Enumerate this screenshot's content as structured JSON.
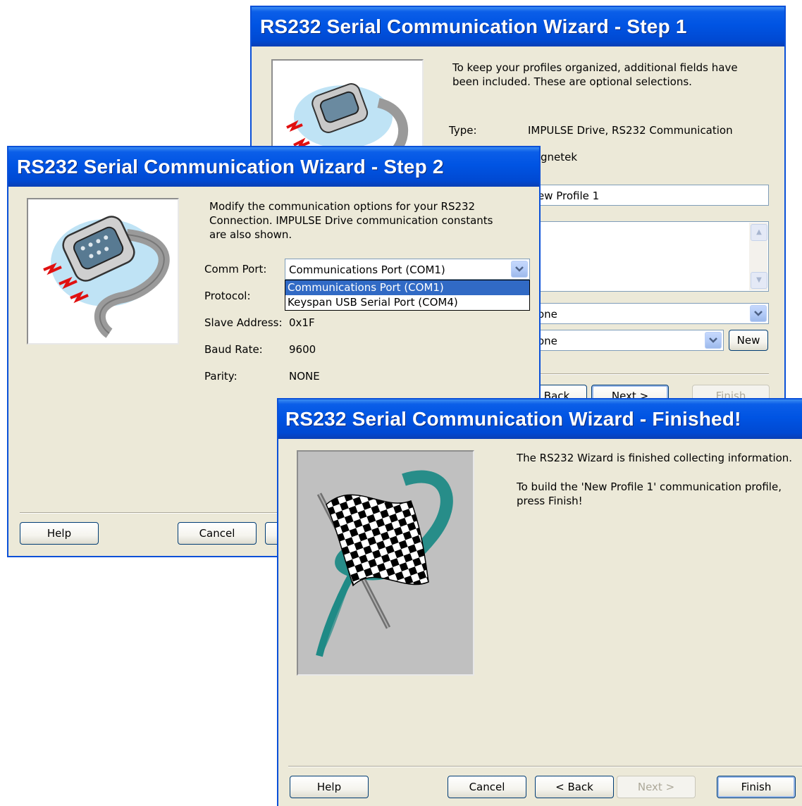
{
  "step1": {
    "title": "RS232 Serial Communication Wizard - Step 1",
    "intro": "To keep your profiles organized, additional fields have been included. These are optional selections.",
    "type_label": "Type:",
    "type_value": "IMPULSE Drive, RS232 Communication",
    "manufacturer_value": "gnetek",
    "profile_name_value": "ew Profile 1",
    "dropdown1_value": "one",
    "dropdown2_value": "one",
    "new_label": "New",
    "back_label": "Back",
    "next_label": "Next >",
    "finish_label": "Finish"
  },
  "step2": {
    "title": "RS232 Serial Communication Wizard - Step 2",
    "intro": "Modify the communication options for your RS232 Connection. IMPULSE Drive communication constants are also shown.",
    "comm_port_label": "Comm Port:",
    "comm_port_value": "Communications Port (COM1)",
    "comm_port_options": [
      "Communications Port (COM1)",
      "Keyspan USB Serial Port (COM4)"
    ],
    "protocol_label": "Protocol:",
    "slave_address_label": "Slave Address:",
    "slave_address_value": "0x1F",
    "baud_rate_label": "Baud Rate:",
    "baud_rate_value": "9600",
    "parity_label": "Parity:",
    "parity_value": "NONE",
    "help_label": "Help",
    "cancel_label": "Cancel"
  },
  "finished": {
    "title": "RS232 Serial Communication Wizard - Finished!",
    "line1": "The RS232 Wizard is finished collecting information.",
    "line2": "To build the 'New Profile 1' communication profile, press Finish!",
    "help_label": "Help",
    "cancel_label": "Cancel",
    "back_label": "< Back",
    "next_label": "Next >",
    "finish_label": "Finish"
  },
  "colors": {
    "titlebar": "#0054e3",
    "dialog_bg": "#ece9d8",
    "selection": "#316ac5",
    "flag_teal": "#1f8a86"
  },
  "icons": [
    "serial-connector-icon",
    "checkered-flag-icon",
    "chevron-down-icon",
    "scroll-up-icon",
    "scroll-down-icon"
  ]
}
